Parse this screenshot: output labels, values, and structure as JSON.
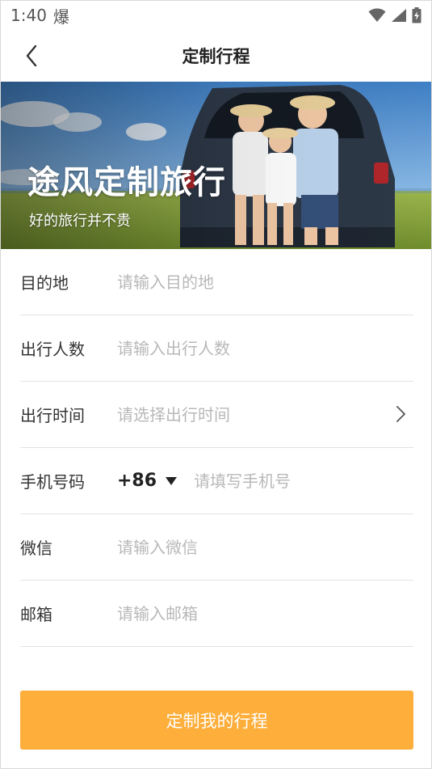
{
  "status_bar": {
    "time": "1:40",
    "notification_glyph": "爆"
  },
  "header": {
    "title": "定制行程"
  },
  "banner": {
    "title": "途风定制旅行",
    "subtitle": "好的旅行并不贵"
  },
  "form": {
    "destination": {
      "label": "目的地",
      "placeholder": "请输入目的地"
    },
    "travelers": {
      "label": "出行人数",
      "placeholder": "请输入出行人数"
    },
    "travel_time": {
      "label": "出行时间",
      "placeholder": "请选择出行时间"
    },
    "phone": {
      "label": "手机号码",
      "country_code": "+86",
      "placeholder": "请填写手机号"
    },
    "wechat": {
      "label": "微信",
      "placeholder": "请输入微信"
    },
    "email": {
      "label": "邮箱",
      "placeholder": "请输入邮箱"
    }
  },
  "submit": {
    "label": "定制我的行程"
  },
  "colors": {
    "accent": "#fdae3b",
    "placeholder": "#b8b8b8",
    "divider": "#e3e3e3"
  },
  "icons": {
    "back": "chevron-left-icon",
    "wifi": "wifi-icon",
    "signal": "cell-signal-icon",
    "battery": "battery-charging-icon",
    "picker": "chevron-right-icon",
    "dropdown": "caret-down-icon"
  }
}
